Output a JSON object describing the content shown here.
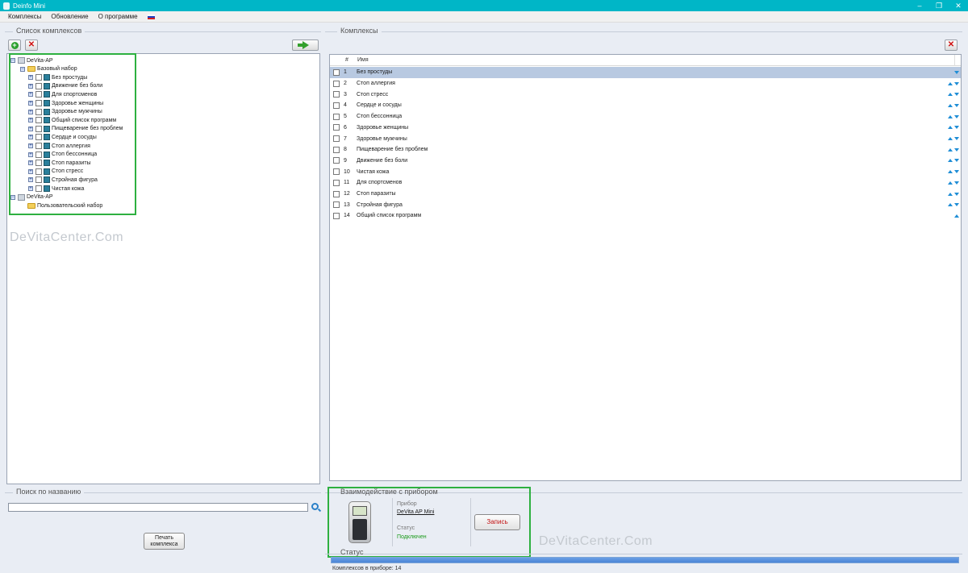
{
  "window": {
    "title": "Deinfo Mini",
    "controls": [
      "–",
      "❐",
      "✕"
    ]
  },
  "menu": {
    "items": [
      "Комплексы",
      "Обновление",
      "О программе"
    ]
  },
  "left_panel": {
    "title": "Список комплексов",
    "tree": [
      {
        "label": "DeVita-AP",
        "level": 0,
        "type": "device",
        "expander": "−"
      },
      {
        "label": "Базовый набор",
        "level": 1,
        "type": "folder",
        "expander": "−"
      },
      {
        "label": "Без простуды",
        "level": 2,
        "type": "program"
      },
      {
        "label": "Движение без боли",
        "level": 2,
        "type": "program"
      },
      {
        "label": "Для спортсменов",
        "level": 2,
        "type": "program"
      },
      {
        "label": "Здоровье женщины",
        "level": 2,
        "type": "program"
      },
      {
        "label": "Здоровье мужчины",
        "level": 2,
        "type": "program"
      },
      {
        "label": "Общий список программ",
        "level": 2,
        "type": "program"
      },
      {
        "label": "Пищеварение без проблем",
        "level": 2,
        "type": "program"
      },
      {
        "label": "Сердце и сосуды",
        "level": 2,
        "type": "program"
      },
      {
        "label": "Стоп аллергия",
        "level": 2,
        "type": "program"
      },
      {
        "label": "Стоп бессонница",
        "level": 2,
        "type": "program"
      },
      {
        "label": "Стоп паразиты",
        "level": 2,
        "type": "program"
      },
      {
        "label": "Стоп стресс",
        "level": 2,
        "type": "program"
      },
      {
        "label": "Стройная фигура",
        "level": 2,
        "type": "program"
      },
      {
        "label": "Чистая кожа",
        "level": 2,
        "type": "program"
      },
      {
        "label": "DeVita-AP",
        "level": 0,
        "type": "device",
        "expander": "−"
      },
      {
        "label": "Пользовательский набор",
        "level": 1,
        "type": "folder"
      }
    ]
  },
  "search": {
    "title": "Поиск по названию",
    "value": "",
    "print_button": "Печать комплекса"
  },
  "right_panel": {
    "title": "Комплексы",
    "columns": [
      "#",
      "Имя"
    ],
    "rows": [
      {
        "num": "1",
        "name": "Без простуды"
      },
      {
        "num": "2",
        "name": "Стоп аллергия"
      },
      {
        "num": "3",
        "name": "Стоп стресс"
      },
      {
        "num": "4",
        "name": "Сердце и сосуды"
      },
      {
        "num": "5",
        "name": "Стоп бессонница"
      },
      {
        "num": "6",
        "name": "Здоровье женщины"
      },
      {
        "num": "7",
        "name": "Здоровье мужчины"
      },
      {
        "num": "8",
        "name": "Пищеварение без проблем"
      },
      {
        "num": "9",
        "name": "Движение без боли"
      },
      {
        "num": "10",
        "name": "Чистая кожа"
      },
      {
        "num": "11",
        "name": "Для спортсменов"
      },
      {
        "num": "12",
        "name": "Стоп паразиты"
      },
      {
        "num": "13",
        "name": "Стройная фигура"
      },
      {
        "num": "14",
        "name": "Общий список программ"
      }
    ]
  },
  "device": {
    "title": "Взаимодействие с прибором",
    "device_label": "Прибор",
    "device_name": "DeVita AP Mini",
    "status_label": "Статус",
    "status_value": "Подключен",
    "write_button": "Запись"
  },
  "status": {
    "title": "Статус",
    "progress": 1.0,
    "bottom_text": "Комплексов в приборе: 14"
  },
  "watermarks": [
    "DeVitaCenter.Com",
    "DeVitaCenter.Com"
  ],
  "colors": {
    "titlebar": "#00b6c7",
    "selection": "#b8c9e1",
    "frame": "#2eb040",
    "status_ok": "#1a9a1a"
  }
}
